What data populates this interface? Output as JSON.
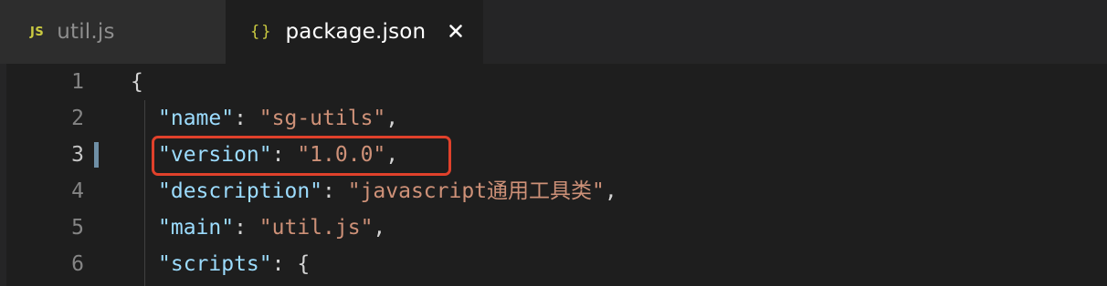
{
  "tabs": [
    {
      "icon": "js-file-icon",
      "icon_text": "JS",
      "label": "util.js",
      "active": false
    },
    {
      "icon": "json-file-icon",
      "icon_text": "{}",
      "label": "package.json",
      "active": true,
      "close_glyph": "✕"
    }
  ],
  "editor": {
    "lines": [
      {
        "number": "1",
        "parts": [
          {
            "t": "{",
            "c": "punc"
          }
        ]
      },
      {
        "number": "2",
        "parts": [
          {
            "t": "\"name\"",
            "c": "key"
          },
          {
            "t": ": ",
            "c": "punc"
          },
          {
            "t": "\"sg-utils\"",
            "c": "str"
          },
          {
            "t": ",",
            "c": "punc"
          }
        ]
      },
      {
        "number": "3",
        "parts": [
          {
            "t": "\"version\"",
            "c": "key"
          },
          {
            "t": ": ",
            "c": "punc"
          },
          {
            "t": "\"1.0.0\"",
            "c": "str"
          },
          {
            "t": ",",
            "c": "punc"
          }
        ]
      },
      {
        "number": "4",
        "parts": [
          {
            "t": "\"description\"",
            "c": "key"
          },
          {
            "t": ": ",
            "c": "punc"
          },
          {
            "t": "\"javascript通用工具类\"",
            "c": "str"
          },
          {
            "t": ",",
            "c": "punc"
          }
        ]
      },
      {
        "number": "5",
        "parts": [
          {
            "t": "\"main\"",
            "c": "key"
          },
          {
            "t": ": ",
            "c": "punc"
          },
          {
            "t": "\"util.js\"",
            "c": "str"
          },
          {
            "t": ",",
            "c": "punc"
          }
        ]
      },
      {
        "number": "6",
        "parts": [
          {
            "t": "\"scripts\"",
            "c": "key"
          },
          {
            "t": ": ",
            "c": "punc"
          },
          {
            "t": "{",
            "c": "punc"
          }
        ]
      }
    ],
    "active_line": "3",
    "highlighted_line": "3"
  },
  "colors": {
    "background": "#1e1e1e",
    "key": "#9cdcfe",
    "string": "#ce9178",
    "highlight_border": "#e0412b",
    "modified_indicator": "#6f8fa6"
  }
}
